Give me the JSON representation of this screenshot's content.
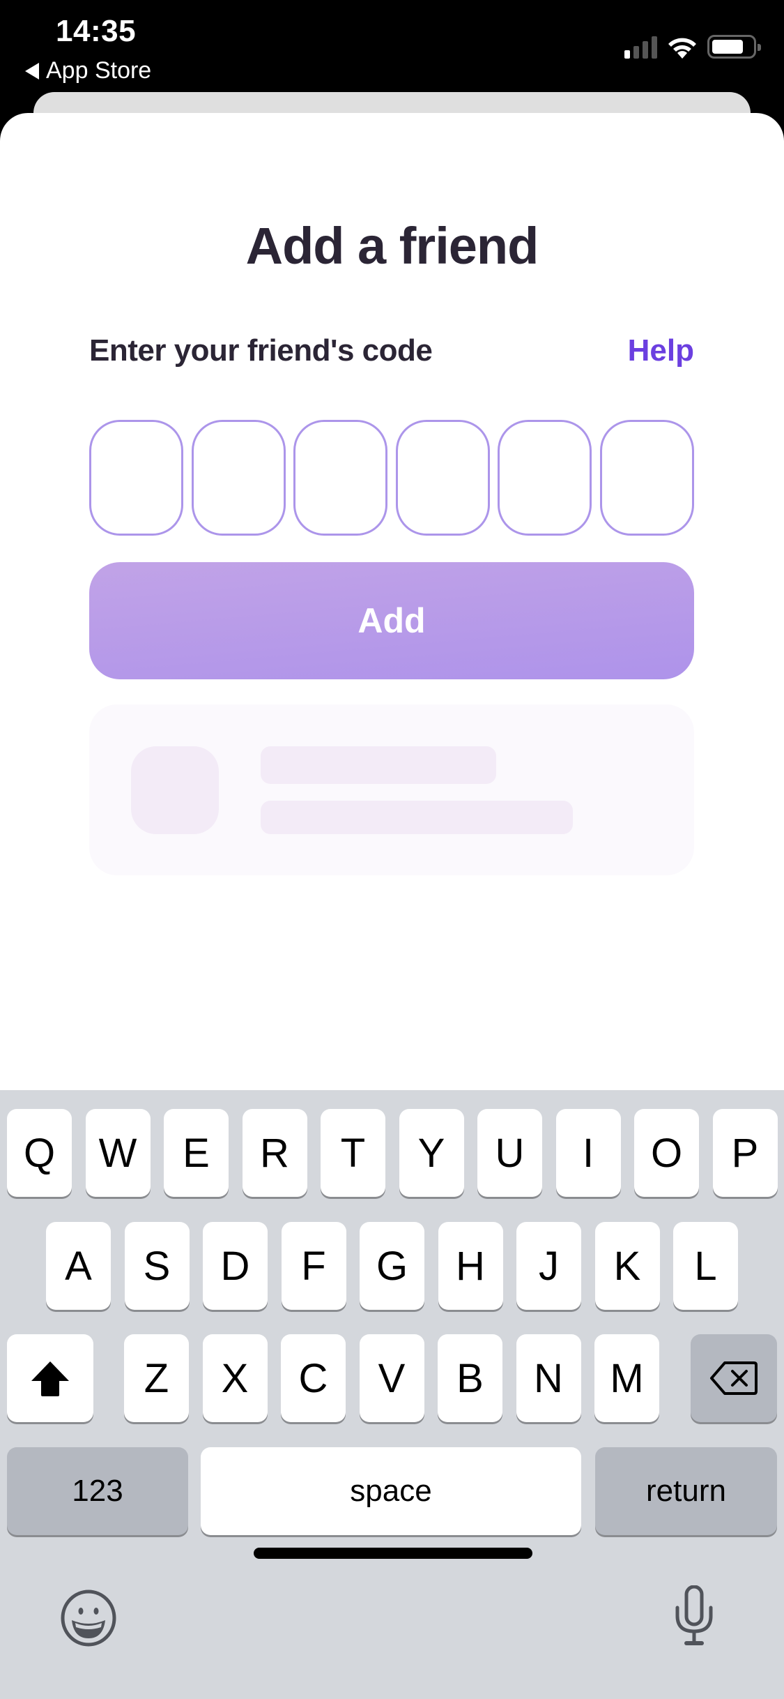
{
  "status_bar": {
    "time": "14:35",
    "back_label": "App Store",
    "battery_level": 0.78
  },
  "screen": {
    "title": "Add a friend",
    "code_label": "Enter your friend's code",
    "help_link": "Help",
    "code_length": 6,
    "code_values": [
      "",
      "",
      "",
      "",
      "",
      ""
    ],
    "add_button": "Add",
    "colors": {
      "accent": "#6B3FE0",
      "box_border": "#AC95EA",
      "button_top": "#C1A3E7",
      "button_bottom": "#AE93EA",
      "text_dark": "#2B2535",
      "skeleton": "#F3EBF7"
    }
  },
  "keyboard": {
    "row1": [
      "Q",
      "W",
      "E",
      "R",
      "T",
      "Y",
      "U",
      "I",
      "O",
      "P"
    ],
    "row2": [
      "A",
      "S",
      "D",
      "F",
      "G",
      "H",
      "J",
      "K",
      "L"
    ],
    "row3": [
      "Z",
      "X",
      "C",
      "V",
      "B",
      "N",
      "M"
    ],
    "shift_icon": "shift-icon",
    "delete_icon": "delete-icon",
    "numbers_key": "123",
    "space_key": "space",
    "return_key": "return",
    "emoji_icon": "emoji-icon",
    "mic_icon": "microphone-icon"
  }
}
